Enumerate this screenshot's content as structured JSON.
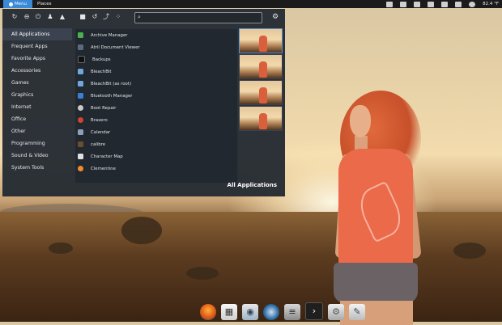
{
  "top_panel": {
    "menu_label": "Menu",
    "places_label": "Places",
    "temperature": "82.4 °F"
  },
  "menu": {
    "search": {
      "placeholder": "",
      "value": ""
    },
    "categories": [
      {
        "label": "All Applications"
      },
      {
        "label": "Frequent Apps"
      },
      {
        "label": "Favorite Apps"
      },
      {
        "label": "Accessories"
      },
      {
        "label": "Games"
      },
      {
        "label": "Graphics"
      },
      {
        "label": "Internet"
      },
      {
        "label": "Office"
      },
      {
        "label": "Other"
      },
      {
        "label": "Programming"
      },
      {
        "label": "Sound & Video"
      },
      {
        "label": "System Tools"
      }
    ],
    "apps": [
      {
        "label": "Archive Manager",
        "color": "#4caf50"
      },
      {
        "label": "Atril Document Viewer",
        "color": "#5a6b7d"
      },
      {
        "label": "Backups",
        "color": "#2c2c2c"
      },
      {
        "label": "BleachBit",
        "color": "#6fa8dc"
      },
      {
        "label": "BleachBit (as root)",
        "color": "#6fa8dc"
      },
      {
        "label": "Bluetooth Manager",
        "color": "#3b7ed4"
      },
      {
        "label": "Boot Repair",
        "color": "#c9c9c9"
      },
      {
        "label": "Brasero",
        "color": "#d0452e"
      },
      {
        "label": "Calendar",
        "color": "#8aa1b8"
      },
      {
        "label": "calibre",
        "color": "#6b4f2c"
      },
      {
        "label": "Character Map",
        "color": "#e0e0e0"
      },
      {
        "label": "Clementine",
        "color": "#f08c2c"
      }
    ],
    "view_label": "All Applications",
    "accent": "#3a8ad8"
  }
}
